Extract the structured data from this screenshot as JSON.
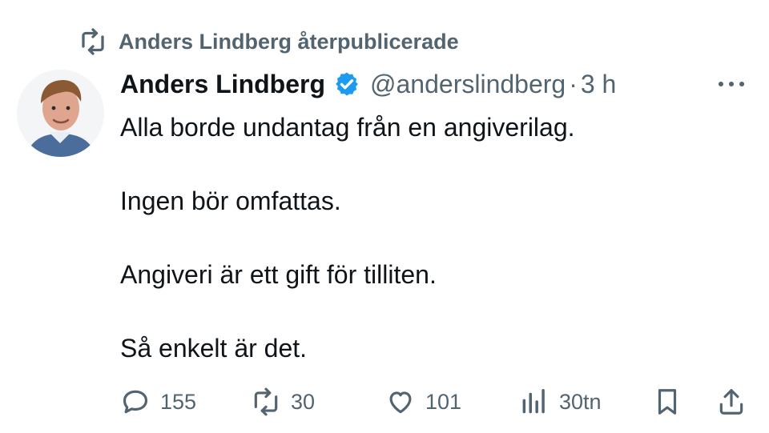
{
  "repost": {
    "label": "Anders Lindberg återpublicerade",
    "icon": "repost-icon"
  },
  "author": {
    "name": "Anders Lindberg",
    "handle": "@anderslindberg",
    "separator": "·",
    "time": "3 h",
    "verified": true,
    "verified_color": "#1d9bf0"
  },
  "tweet": {
    "paragraphs": [
      "Alla borde undantag från en angiverilag.",
      "Ingen bör omfattas.",
      "Angiveri är ett gift för tilliten.",
      "Så enkelt är det."
    ]
  },
  "actions": {
    "replies": "155",
    "reposts": "30",
    "likes": "101",
    "views": "30tn"
  },
  "colors": {
    "text": "#0f1419",
    "muted": "#536471",
    "accent": "#1d9bf0"
  }
}
